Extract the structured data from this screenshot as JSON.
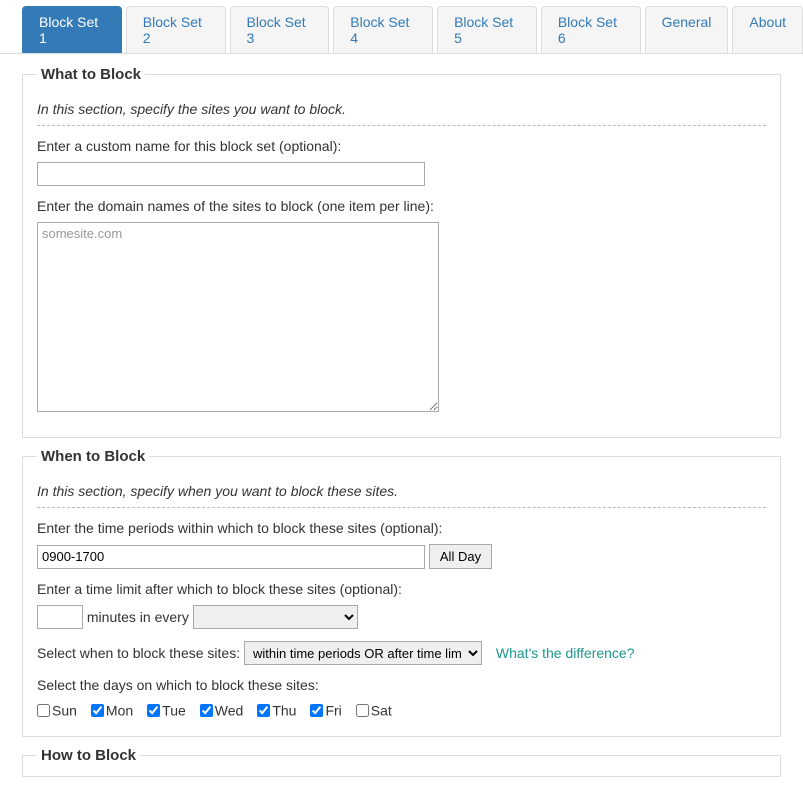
{
  "tabs": {
    "items": [
      {
        "label": "Block Set 1",
        "active": true
      },
      {
        "label": "Block Set 2",
        "active": false
      },
      {
        "label": "Block Set 3",
        "active": false
      },
      {
        "label": "Block Set 4",
        "active": false
      },
      {
        "label": "Block Set 5",
        "active": false
      },
      {
        "label": "Block Set 6",
        "active": false
      },
      {
        "label": "General",
        "active": false
      },
      {
        "label": "About",
        "active": false
      }
    ]
  },
  "what": {
    "legend": "What to Block",
    "desc": "In this section, specify the sites you want to block.",
    "name_label": "Enter a custom name for this block set (optional):",
    "name_value": "",
    "sites_label": "Enter the domain names of the sites to block (one item per line):",
    "sites_value": "somesite.com"
  },
  "when": {
    "legend": "When to Block",
    "desc": "In this section, specify when you want to block these sites.",
    "periods_label": "Enter the time periods within which to block these sites (optional):",
    "periods_value": "0900-1700",
    "allday_label": "All Day",
    "limit_label": "Enter a time limit after which to block these sites (optional):",
    "minutes_value": "",
    "minutes_text": "minutes in every",
    "period_selected": "",
    "logic_label": "Select when to block these sites:",
    "logic_selected": "within time periods OR after time limit",
    "difference_link": "What's the difference?",
    "days_label": "Select the days on which to block these sites:",
    "days": [
      {
        "label": "Sun",
        "checked": false
      },
      {
        "label": "Mon",
        "checked": true
      },
      {
        "label": "Tue",
        "checked": true
      },
      {
        "label": "Wed",
        "checked": true
      },
      {
        "label": "Thu",
        "checked": true
      },
      {
        "label": "Fri",
        "checked": true
      },
      {
        "label": "Sat",
        "checked": false
      }
    ]
  },
  "how": {
    "legend": "How to Block"
  }
}
